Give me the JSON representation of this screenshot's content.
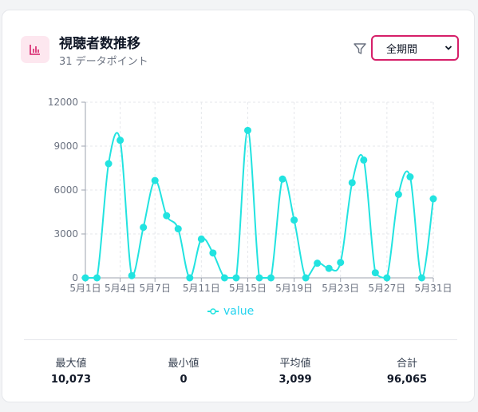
{
  "header": {
    "title": "視聴者数推移",
    "subtitle": "31 データポイント",
    "icon": "bar-chart-icon",
    "filter_icon": "filter-icon",
    "period_select": {
      "value": "全期間"
    }
  },
  "chart_data": {
    "type": "line",
    "x": [
      "5月1日",
      "5月2日",
      "5月3日",
      "5月4日",
      "5月5日",
      "5月6日",
      "5月7日",
      "5月8日",
      "5月9日",
      "5月10日",
      "5月11日",
      "5月12日",
      "5月13日",
      "5月14日",
      "5月15日",
      "5月16日",
      "5月17日",
      "5月18日",
      "5月19日",
      "5月20日",
      "5月21日",
      "5月22日",
      "5月23日",
      "5月24日",
      "5月25日",
      "5月26日",
      "5月27日",
      "5月28日",
      "5月29日",
      "5月30日",
      "5月31日"
    ],
    "x_tick_labels": [
      "5月1日",
      "5月4日",
      "5月7日",
      "5月11日",
      "5月15日",
      "5月19日",
      "5月23日",
      "5月27日",
      "5月31日"
    ],
    "series": [
      {
        "name": "value",
        "color": "#22e3e0",
        "values": [
          0,
          0,
          7800,
          9400,
          150,
          3450,
          6650,
          4250,
          3350,
          0,
          2650,
          1700,
          0,
          0,
          10073,
          0,
          0,
          6750,
          3950,
          0,
          1000,
          650,
          1050,
          6500,
          8050,
          350,
          0,
          5700,
          6900,
          0,
          5400
        ]
      }
    ],
    "y_ticks": [
      "0",
      "3000",
      "6000",
      "9000",
      "12000"
    ],
    "ylim": [
      0,
      12000
    ],
    "grid": true,
    "legend": "bottom-center"
  },
  "stats": [
    {
      "label": "最大値",
      "value": "10,073"
    },
    {
      "label": "最小値",
      "value": "0"
    },
    {
      "label": "平均値",
      "value": "3,099"
    },
    {
      "label": "合計",
      "value": "96,065"
    }
  ]
}
